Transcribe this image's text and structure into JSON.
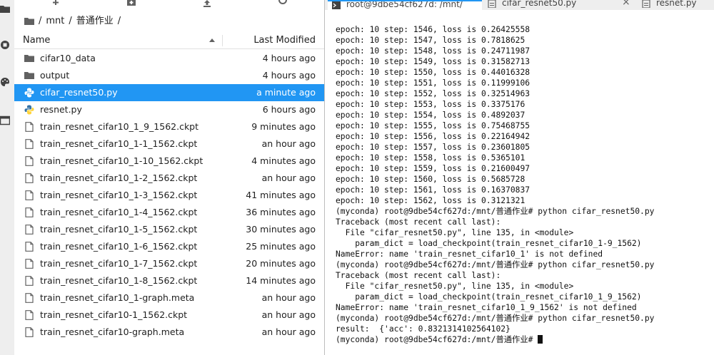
{
  "file_browser": {
    "breadcrumb": {
      "root": "/",
      "segment1": "mnt",
      "sep": "/",
      "segment2": "普通作业",
      "trail": "/"
    },
    "columns": {
      "name": "Name",
      "modified": "Last Modified"
    },
    "items": [
      {
        "name": "cifar10_data",
        "modified": "4 hours ago",
        "type": "folder",
        "selected": false
      },
      {
        "name": "output",
        "modified": "4 hours ago",
        "type": "folder",
        "selected": false
      },
      {
        "name": "cifar_resnet50.py",
        "modified": "a minute ago",
        "type": "python",
        "selected": true
      },
      {
        "name": "resnet.py",
        "modified": "6 hours ago",
        "type": "python",
        "selected": false
      },
      {
        "name": "train_resnet_cifar10_1_9_1562.ckpt",
        "modified": "9 minutes ago",
        "type": "file",
        "selected": false
      },
      {
        "name": "train_resnet_cifar10_1-1_1562.ckpt",
        "modified": "an hour ago",
        "type": "file",
        "selected": false
      },
      {
        "name": "train_resnet_cifar10_1-10_1562.ckpt",
        "modified": "4 minutes ago",
        "type": "file",
        "selected": false
      },
      {
        "name": "train_resnet_cifar10_1-2_1562.ckpt",
        "modified": "an hour ago",
        "type": "file",
        "selected": false
      },
      {
        "name": "train_resnet_cifar10_1-3_1562.ckpt",
        "modified": "41 minutes ago",
        "type": "file",
        "selected": false
      },
      {
        "name": "train_resnet_cifar10_1-4_1562.ckpt",
        "modified": "36 minutes ago",
        "type": "file",
        "selected": false
      },
      {
        "name": "train_resnet_cifar10_1-5_1562.ckpt",
        "modified": "30 minutes ago",
        "type": "file",
        "selected": false
      },
      {
        "name": "train_resnet_cifar10_1-6_1562.ckpt",
        "modified": "25 minutes ago",
        "type": "file",
        "selected": false
      },
      {
        "name": "train_resnet_cifar10_1-7_1562.ckpt",
        "modified": "20 minutes ago",
        "type": "file",
        "selected": false
      },
      {
        "name": "train_resnet_cifar10_1-8_1562.ckpt",
        "modified": "14 minutes ago",
        "type": "file",
        "selected": false
      },
      {
        "name": "train_resnet_cifar10_1-graph.meta",
        "modified": "an hour ago",
        "type": "file",
        "selected": false
      },
      {
        "name": "train_resnet_cifar10-1_1562.ckpt",
        "modified": "an hour ago",
        "type": "file",
        "selected": false
      },
      {
        "name": "train_resnet_cifar10-graph.meta",
        "modified": "an hour ago",
        "type": "file",
        "selected": false
      }
    ]
  },
  "tabs": [
    {
      "label": "root@9dbe54cf627d: /mnt/",
      "icon": "terminal-icon",
      "active": true
    },
    {
      "label": "cifar_resnet50.py",
      "icon": "file-icon",
      "active": false
    },
    {
      "label": "resnet.py",
      "icon": "file-icon",
      "active": false
    }
  ],
  "terminal": {
    "lines": [
      "epoch: 10 step: 1546, loss is 0.26425558",
      "epoch: 10 step: 1547, loss is 0.7818625",
      "epoch: 10 step: 1548, loss is 0.24711987",
      "epoch: 10 step: 1549, loss is 0.31582713",
      "epoch: 10 step: 1550, loss is 0.44016328",
      "epoch: 10 step: 1551, loss is 0.11999106",
      "epoch: 10 step: 1552, loss is 0.32514963",
      "epoch: 10 step: 1553, loss is 0.3375176",
      "epoch: 10 step: 1554, loss is 0.4892037",
      "epoch: 10 step: 1555, loss is 0.75468755",
      "epoch: 10 step: 1556, loss is 0.22164942",
      "epoch: 10 step: 1557, loss is 0.23601805",
      "epoch: 10 step: 1558, loss is 0.5365101",
      "epoch: 10 step: 1559, loss is 0.21600497",
      "epoch: 10 step: 1560, loss is 0.5685728",
      "epoch: 10 step: 1561, loss is 0.16370837",
      "epoch: 10 step: 1562, loss is 0.3121321",
      "(myconda) root@9dbe54cf627d:/mnt/普通作业# python cifar_resnet50.py",
      "Traceback (most recent call last):",
      "  File \"cifar_resnet50.py\", line 135, in <module>",
      "    param_dict = load_checkpoint(train_resnet_cifar10_1-9_1562)",
      "NameError: name 'train_resnet_cifar10_1' is not defined",
      "(myconda) root@9dbe54cf627d:/mnt/普通作业# python cifar_resnet50.py",
      "Traceback (most recent call last):",
      "  File \"cifar_resnet50.py\", line 135, in <module>",
      "    param_dict = load_checkpoint(train_resnet_cifar10_1_9_1562)",
      "NameError: name 'train_resnet_cifar10_1_9_1562' is not defined",
      "(myconda) root@9dbe54cf627d:/mnt/普通作业# python cifar_resnet50.py",
      "result:  {'acc': 0.8321314102564102}"
    ],
    "prompt": "(myconda) root@9dbe54cf627d:/mnt/普通作业# "
  },
  "colors": {
    "selection": "#2196f3",
    "python_icon_blue": "#3572a5",
    "python_icon_yellow": "#ffd43b",
    "folder_icon": "#616161"
  }
}
